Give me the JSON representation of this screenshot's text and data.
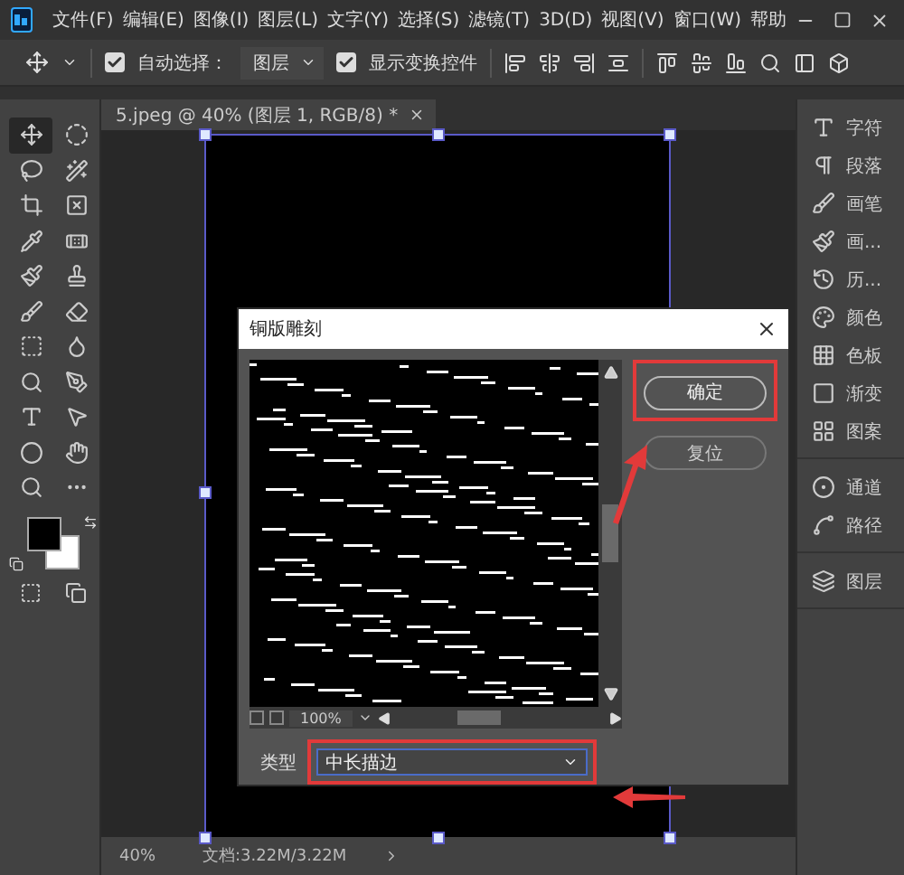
{
  "menu_bar": {
    "items": [
      "文件(F)",
      "编辑(E)",
      "图像(I)",
      "图层(L)",
      "文字(Y)",
      "选择(S)",
      "滤镜(T)",
      "3D(D)",
      "视图(V)",
      "窗口(W)",
      "帮助"
    ]
  },
  "options_bar": {
    "auto_select": {
      "label": "自动选择：",
      "checked": true
    },
    "layer_select": {
      "value": "图层"
    },
    "show_transform": {
      "label": "显示变换控件",
      "checked": true
    }
  },
  "tools": [
    {
      "selected": true
    },
    {
      "selected": false
    },
    {
      "selected": false
    },
    {
      "selected": false
    },
    {
      "selected": false
    },
    {
      "selected": false
    },
    {
      "selected": false
    },
    {
      "selected": false
    },
    {
      "selected": false
    },
    {
      "selected": false
    },
    {
      "selected": false
    },
    {
      "selected": false
    },
    {
      "selected": false
    },
    {
      "selected": false
    },
    {
      "selected": false
    },
    {
      "selected": false
    },
    {
      "selected": false
    },
    {
      "selected": false
    },
    {
      "selected": false
    },
    {
      "selected": false
    },
    {
      "selected": false
    },
    {
      "selected": false
    }
  ],
  "document_tab": {
    "title": "5.jpeg @ 40% (图层 1, RGB/8) *"
  },
  "panels": [
    {
      "items": [
        {
          "label": "字符"
        },
        {
          "label": "段落"
        },
        {
          "label": "画笔"
        },
        {
          "label": "画..."
        },
        {
          "label": "历..."
        },
        {
          "label": "颜色"
        },
        {
          "label": "色板"
        },
        {
          "label": "渐变"
        },
        {
          "label": "图案"
        }
      ]
    },
    {
      "items": [
        {
          "label": "通道"
        },
        {
          "label": "路径"
        }
      ]
    },
    {
      "items": [
        {
          "label": "图层"
        }
      ]
    }
  ],
  "dialog": {
    "title": "铜版雕刻",
    "zoom": "100%",
    "buttons": [
      {
        "label": "确定",
        "highlighted": true
      },
      {
        "label": "复位",
        "highlighted": false
      }
    ],
    "type": {
      "label": "类型",
      "value": "中长描边",
      "highlighted": true
    }
  },
  "status_bar": {
    "zoom": "40%",
    "document": "文档:3.22M/3.22M"
  }
}
